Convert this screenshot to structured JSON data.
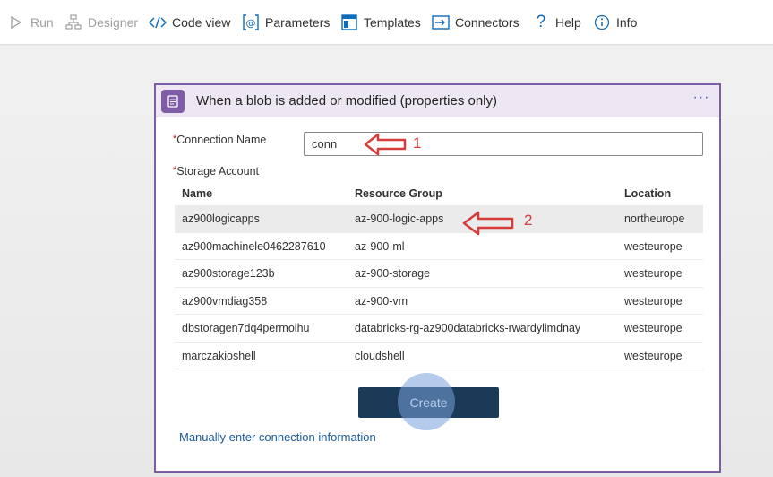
{
  "toolbar": {
    "items": [
      {
        "label": "Run",
        "icon": "play-icon",
        "disabled": true
      },
      {
        "label": "Designer",
        "icon": "designer-icon",
        "disabled": true
      },
      {
        "label": "Code view",
        "icon": "code-icon",
        "disabled": false
      },
      {
        "label": "Parameters",
        "icon": "parameters-icon",
        "disabled": false
      },
      {
        "label": "Templates",
        "icon": "templates-icon",
        "disabled": false
      },
      {
        "label": "Connectors",
        "icon": "connectors-icon",
        "disabled": false
      },
      {
        "label": "Help",
        "icon": "help-icon",
        "disabled": false
      },
      {
        "label": "Info",
        "icon": "info-icon",
        "disabled": false
      }
    ]
  },
  "card": {
    "title": "When a blob is added or modified (properties only)",
    "more": "···",
    "connection_label": "Connection Name",
    "connection_value": "conn",
    "storage_label": "Storage Account",
    "required_marker": "*",
    "columns": [
      "Name",
      "Resource Group",
      "Location"
    ],
    "rows": [
      {
        "name": "az900logicapps",
        "group": "az-900-logic-apps",
        "location": "northeurope",
        "selected": true
      },
      {
        "name": "az900machinele0462287610",
        "group": "az-900-ml",
        "location": "westeurope",
        "selected": false
      },
      {
        "name": "az900storage123b",
        "group": "az-900-storage",
        "location": "westeurope",
        "selected": false
      },
      {
        "name": "az900vmdiag358",
        "group": "az-900-vm",
        "location": "westeurope",
        "selected": false
      },
      {
        "name": "dbstoragen7dq4permoihu",
        "group": "databricks-rg-az900databricks-rwardylimdnay",
        "location": "westeurope",
        "selected": false
      },
      {
        "name": "marczakioshell",
        "group": "cloudshell",
        "location": "westeurope",
        "selected": false
      }
    ],
    "create_label": "Create",
    "manual_link": "Manually enter connection information"
  },
  "annotations": {
    "first": "1",
    "second": "2"
  },
  "colors": {
    "accent": "#7e5ca6",
    "button": "#1b3a57",
    "annotation": "#d83b3b"
  }
}
